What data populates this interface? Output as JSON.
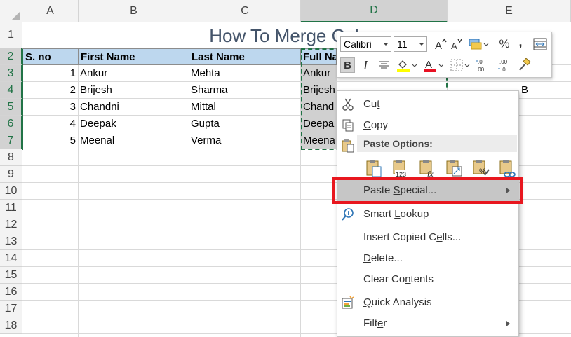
{
  "spreadsheet": {
    "columns": [
      "A",
      "B",
      "C",
      "D",
      "E"
    ],
    "rows": [
      "1",
      "2",
      "3",
      "4",
      "5",
      "6",
      "7",
      "8",
      "9",
      "10",
      "11",
      "12",
      "13",
      "14",
      "15",
      "16",
      "17",
      "18"
    ],
    "title": "How To Merge Colum",
    "headers": {
      "a": "S. no",
      "b": "First Name",
      "c": "Last Name",
      "d": "Full Na"
    },
    "data": [
      {
        "a": "1",
        "b": "Ankur",
        "c": "Mehta",
        "d": "Ankur"
      },
      {
        "a": "2",
        "b": "Brijesh",
        "c": "Sharma",
        "d": "Brijesh Sharma"
      },
      {
        "a": "3",
        "b": "Chandni",
        "c": "Mittal",
        "d": "Chand"
      },
      {
        "a": "4",
        "b": "Deepak",
        "c": "Gupta",
        "d": "Deepa"
      },
      {
        "a": "5",
        "b": "Meenal",
        "c": "Verma",
        "d": "Meena"
      }
    ],
    "col_e_partial": [
      "",
      "B"
    ]
  },
  "mini_toolbar": {
    "font": "Calibri",
    "size": "11",
    "bold": "B",
    "italic": "I",
    "percent": "%",
    "comma": ","
  },
  "context_menu": {
    "cut": {
      "pre": "Cu",
      "key": "t",
      "post": ""
    },
    "copy": {
      "pre": "",
      "key": "C",
      "post": "opy"
    },
    "paste_options_header": "Paste Options:",
    "paste_special": {
      "pre": "Paste ",
      "key": "S",
      "post": "pecial..."
    },
    "smart_lookup": {
      "pre": "Smart ",
      "key": "L",
      "post": "ookup"
    },
    "insert_copied": {
      "pre": "Insert Copied C",
      "key": "e",
      "post": "lls..."
    },
    "delete": {
      "pre": "",
      "key": "D",
      "post": "elete..."
    },
    "clear_contents": {
      "pre": "Clear Co",
      "key": "n",
      "post": "tents"
    },
    "quick_analysis": {
      "pre": "",
      "key": "Q",
      "post": "uick Analysis"
    },
    "filter": {
      "pre": "Filt",
      "key": "e",
      "post": "r"
    }
  },
  "colors": {
    "accent_green": "#217346",
    "header_fill": "#bdd7ee",
    "highlight_red": "#e8171f",
    "title_color": "#44546a"
  }
}
